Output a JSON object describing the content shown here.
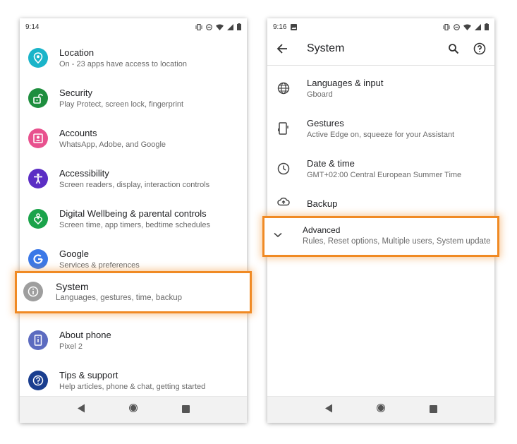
{
  "colors": {
    "highlight": "#f08a24",
    "location": "#1ab4c9",
    "security": "#1e8e3e",
    "accounts": "#e8518e",
    "accessibility": "#5b2dc4",
    "wellbeing": "#1aa34a",
    "google": "#3b78e7",
    "system": "#9e9e9e",
    "about": "#5c6bc0",
    "tips": "#1a3e8f"
  },
  "left": {
    "status": {
      "time": "9:14"
    },
    "items": [
      {
        "title": "Location",
        "subtitle": "On - 23 apps have access to location",
        "icon": "location-pin-icon"
      },
      {
        "title": "Security",
        "subtitle": "Play Protect, screen lock, fingerprint",
        "icon": "lock-icon"
      },
      {
        "title": "Accounts",
        "subtitle": "WhatsApp, Adobe, and Google",
        "icon": "account-box-icon"
      },
      {
        "title": "Accessibility",
        "subtitle": "Screen readers, display, interaction controls",
        "icon": "accessibility-icon"
      },
      {
        "title": "Digital Wellbeing & parental controls",
        "subtitle": "Screen time, app timers, bedtime schedules",
        "icon": "wellbeing-heart-icon"
      },
      {
        "title": "Google",
        "subtitle": "Services & preferences",
        "icon": "google-g-icon"
      },
      {
        "title": "System",
        "subtitle": "Languages, gestures, time, backup",
        "icon": "info-icon"
      },
      {
        "title": "About phone",
        "subtitle": "Pixel 2",
        "icon": "phone-icon"
      },
      {
        "title": "Tips & support",
        "subtitle": "Help articles, phone & chat, getting started",
        "icon": "help-icon"
      }
    ]
  },
  "right": {
    "status": {
      "time": "9:16"
    },
    "appbar": {
      "title": "System"
    },
    "items": [
      {
        "title": "Languages & input",
        "subtitle": "Gboard",
        "icon": "globe-icon"
      },
      {
        "title": "Gestures",
        "subtitle": "Active Edge on, squeeze for your Assistant",
        "icon": "gesture-phone-icon"
      },
      {
        "title": "Date & time",
        "subtitle": "GMT+02:00 Central European Summer Time",
        "icon": "clock-icon"
      },
      {
        "title": "Backup",
        "subtitle": "",
        "icon": "cloud-upload-icon"
      },
      {
        "title": "Advanced",
        "subtitle": "Rules, Reset options, Multiple users, System update",
        "icon": "chevron-down-icon"
      }
    ]
  }
}
